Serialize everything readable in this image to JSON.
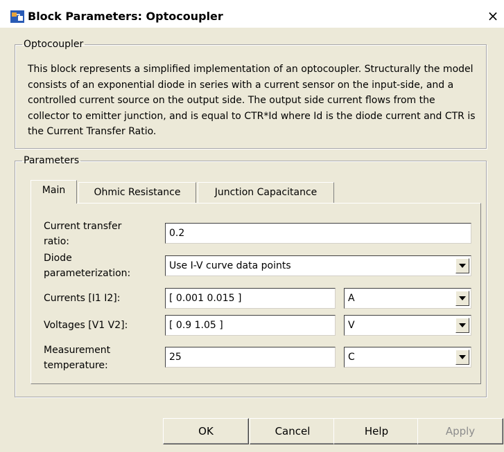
{
  "window": {
    "title": "Block Parameters: Optocoupler",
    "close_glyph": "×",
    "icon": "simulink-block-icon"
  },
  "description_group": {
    "legend": "Optocoupler",
    "text": "This block represents a simplified implementation of an optocoupler. Structurally the model consists of an exponential diode in series with a current sensor on the input-side, and a controlled current source on the output side. The output side current flows from the collector to emitter junction, and is equal to CTR*Id where Id is the diode current and CTR is the Current Transfer Ratio."
  },
  "parameters_group": {
    "legend": "Parameters",
    "tabs": [
      {
        "label": "Main",
        "active": true
      },
      {
        "label": "Ohmic Resistance",
        "active": false
      },
      {
        "label": "Junction Capacitance",
        "active": false
      }
    ],
    "fields": {
      "ctr": {
        "label_line1": "Current transfer",
        "label_line2": "ratio:",
        "value": "0.2"
      },
      "diode_param": {
        "label_line1": "Diode",
        "label_line2": "parameterization:",
        "value": "Use I-V curve data points"
      },
      "currents": {
        "label": "Currents [I1 I2]:",
        "value": "[ 0.001 0.015 ]",
        "unit": "A"
      },
      "voltages": {
        "label": "Voltages [V1 V2]:",
        "value": "[ 0.9 1.05 ]",
        "unit": "V"
      },
      "temperature": {
        "label_line1": "Measurement",
        "label_line2": "temperature:",
        "value": "25",
        "unit": "C"
      }
    }
  },
  "buttons": {
    "ok": "OK",
    "cancel": "Cancel",
    "help": "Help",
    "apply": "Apply"
  }
}
